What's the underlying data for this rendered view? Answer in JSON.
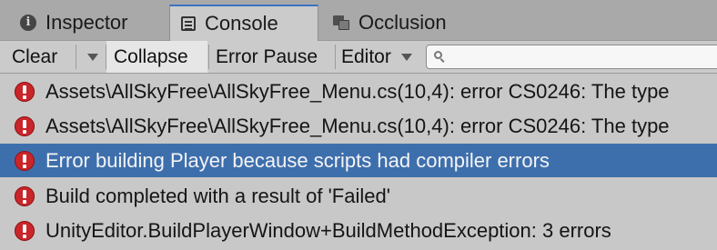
{
  "tabs": [
    {
      "label": "Inspector",
      "icon": "info-icon",
      "active": false
    },
    {
      "label": "Console",
      "icon": "console-icon",
      "active": true
    },
    {
      "label": "Occlusion",
      "icon": "occlusion-icon",
      "active": false
    }
  ],
  "toolbar": {
    "clear_label": "Clear",
    "collapse_label": "Collapse",
    "collapse_pressed": true,
    "error_pause_label": "Error Pause",
    "editor_label": "Editor",
    "search_placeholder": "",
    "search_value": ""
  },
  "log": {
    "selected_index": 2,
    "entries": [
      {
        "type": "error",
        "message": "Assets\\AllSkyFree\\AllSkyFree_Menu.cs(10,4): error CS0246: The type"
      },
      {
        "type": "error",
        "message": "Assets\\AllSkyFree\\AllSkyFree_Menu.cs(10,4): error CS0246: The type"
      },
      {
        "type": "error",
        "message": "Error building Player because scripts had compiler errors"
      },
      {
        "type": "error",
        "message": "Build completed with a result of 'Failed'"
      },
      {
        "type": "error",
        "message": "UnityEditor.BuildPlayerWindow+BuildMethodException: 3 errors"
      }
    ]
  },
  "colors": {
    "selection": "#3e6fad",
    "error_icon": "#c9262a",
    "active_tab_accent": "#3a72c4"
  }
}
